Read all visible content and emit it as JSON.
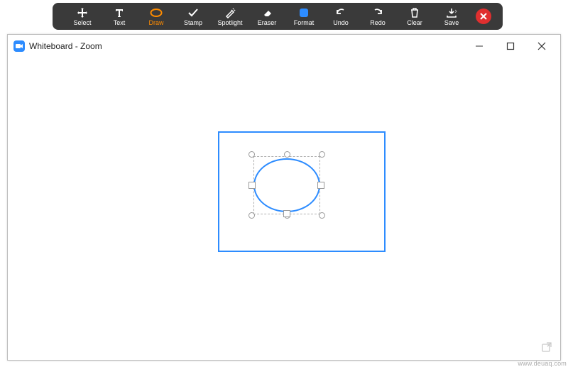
{
  "toolbar": {
    "tools": [
      {
        "name": "select",
        "label": "Select",
        "active": false
      },
      {
        "name": "text",
        "label": "Text",
        "active": false
      },
      {
        "name": "draw",
        "label": "Draw",
        "active": true
      },
      {
        "name": "stamp",
        "label": "Stamp",
        "active": false
      },
      {
        "name": "spotlight",
        "label": "Spotlight",
        "active": false
      },
      {
        "name": "eraser",
        "label": "Eraser",
        "active": false
      },
      {
        "name": "format",
        "label": "Format",
        "active": false
      },
      {
        "name": "undo",
        "label": "Undo",
        "active": false
      },
      {
        "name": "redo",
        "label": "Redo",
        "active": false
      },
      {
        "name": "clear",
        "label": "Clear",
        "active": false
      },
      {
        "name": "save",
        "label": "Save",
        "active": false
      }
    ]
  },
  "window": {
    "title": "Whiteboard - Zoom"
  },
  "colors": {
    "accent": "#2d8cff",
    "active_tool": "#ff8c00",
    "toolbar_bg": "#3a3a3a"
  },
  "watermark": "www.deuaq.com"
}
